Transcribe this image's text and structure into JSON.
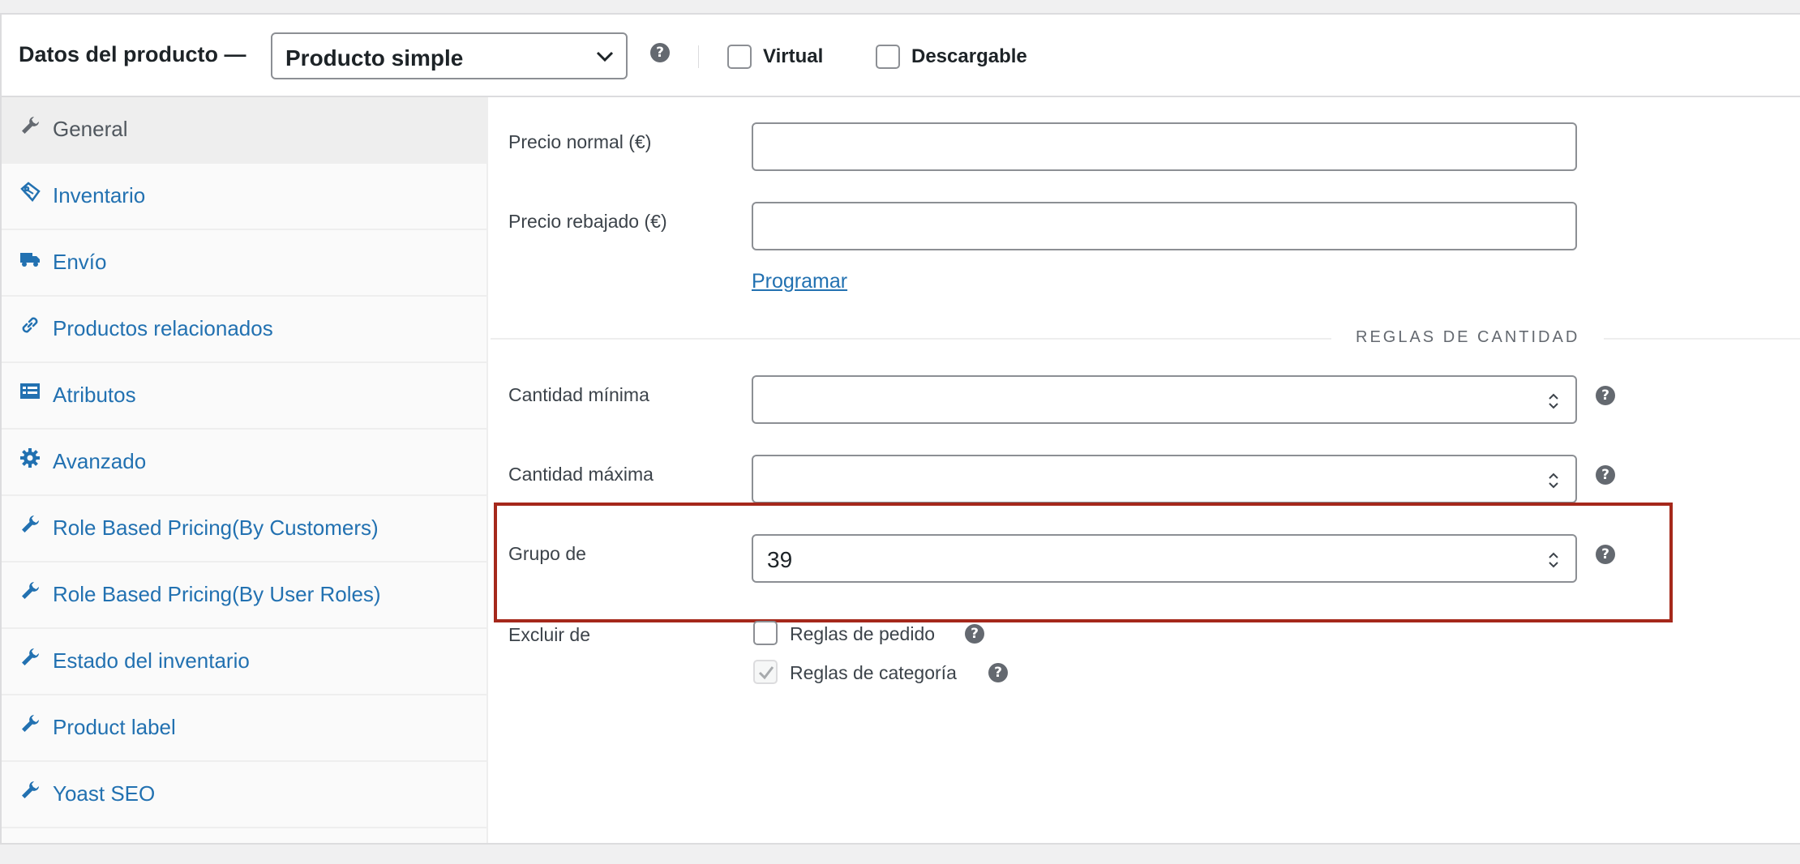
{
  "header": {
    "title": "Datos del producto —",
    "product_type": "Producto simple",
    "virtual_label": "Virtual",
    "downloadable_label": "Descargable"
  },
  "sidebar": {
    "items": [
      {
        "label": "General",
        "icon": "wrench-icon",
        "active": true
      },
      {
        "label": "Inventario",
        "icon": "tag-icon"
      },
      {
        "label": "Envío",
        "icon": "truck-icon"
      },
      {
        "label": "Productos relacionados",
        "icon": "link-icon"
      },
      {
        "label": "Atributos",
        "icon": "list-card-icon"
      },
      {
        "label": "Avanzado",
        "icon": "gear-icon"
      },
      {
        "label": "Role Based Pricing(By Customers)",
        "icon": "wrench-icon"
      },
      {
        "label": "Role Based Pricing(By User Roles)",
        "icon": "wrench-icon"
      },
      {
        "label": "Estado del inventario",
        "icon": "wrench-icon"
      },
      {
        "label": "Product label",
        "icon": "wrench-icon"
      },
      {
        "label": "Yoast SEO",
        "icon": "wrench-icon"
      }
    ]
  },
  "general": {
    "regular_price_label": "Precio normal (€)",
    "regular_price_value": "",
    "sale_price_label": "Precio rebajado (€)",
    "sale_price_value": "",
    "schedule_link": "Programar",
    "quantity_rules_title": "REGLAS DE CANTIDAD",
    "min_qty_label": "Cantidad mínima",
    "min_qty_value": "",
    "max_qty_label": "Cantidad máxima",
    "max_qty_value": "",
    "group_of_label": "Grupo de",
    "group_of_value": "39",
    "exclude_label": "Excluir de",
    "exclude_order_rules": "Reglas de pedido",
    "exclude_category_rules": "Reglas de categoría"
  },
  "colors": {
    "link": "#2271b1",
    "highlight_border": "#a5281b"
  }
}
